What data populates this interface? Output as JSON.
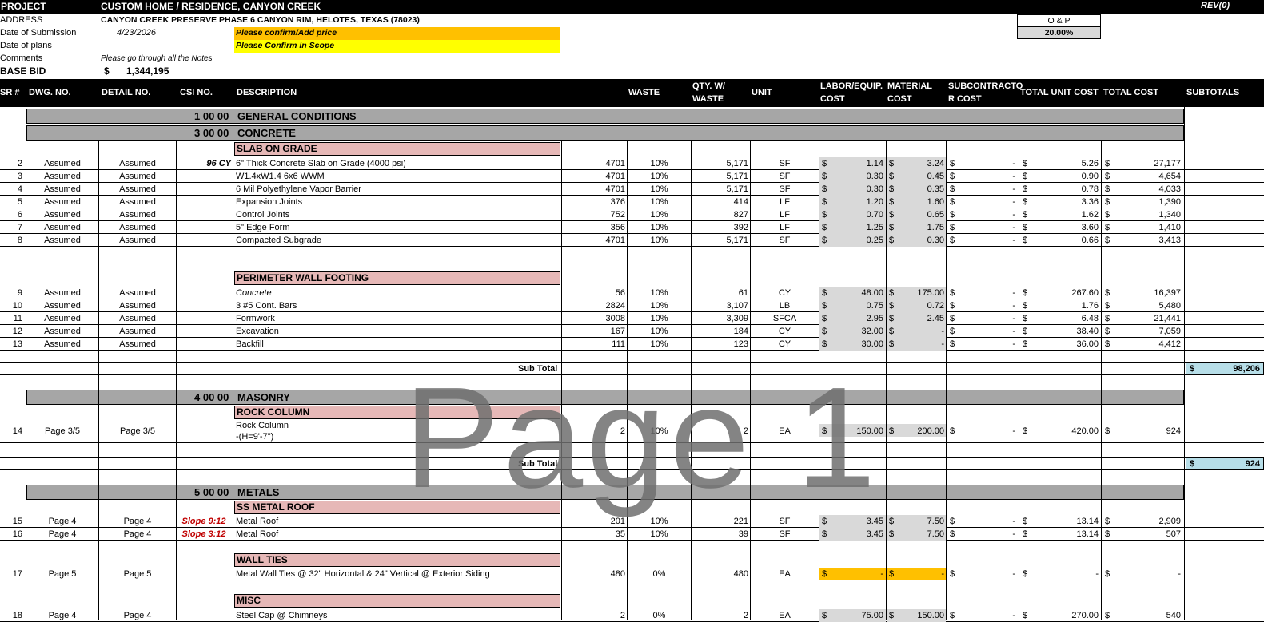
{
  "header": {
    "project_label": "PROJECT",
    "project_value": "CUSTOM HOME / RESIDENCE, CANYON CREEK",
    "rev": "REV(0)",
    "address_label": "ADDRESS",
    "address_value": "CANYON CREEK PRESERVE PHASE 6 CANYON RIM, HELOTES, TEXAS (78023)",
    "submission_label": "Date of Submission",
    "submission_value": "4/23/2026",
    "plans_label": "Date of plans",
    "comments_label": "Comments",
    "comments_value": "Please go through all the Notes",
    "base_bid_label": "BASE BID",
    "base_bid_currency": "$",
    "base_bid_value": "1,344,195",
    "note_confirm_price": "Please confirm/Add price",
    "note_confirm_scope": "Please Confirm in Scope",
    "op_label": "O & P",
    "op_value": "20.00%",
    "colors": {
      "gold": "#ffc000",
      "yellow": "#ffff00",
      "pink": "#e6b8b7",
      "grey": "#a6a6a6",
      "blue": "#b7dee8"
    }
  },
  "columns": {
    "sr": "SR #",
    "dwg": "DWG. NO.",
    "detail": "DETAIL NO.",
    "csi": "CSI NO.",
    "desc": "DESCRIPTION",
    "waste": "WASTE",
    "qty1": "QTY. W/",
    "qty2": "WASTE",
    "unit": "UNIT",
    "labor1": "LABOR/EQUIP.",
    "labor2": "COST",
    "mat1": "MATERIAL",
    "mat2": "COST",
    "subc1": "SUBCONTRACTO",
    "subc2": "R COST",
    "tuc": "TOTAL UNIT COST",
    "tc": "TOTAL COST",
    "subtotals": "SUBTOTALS"
  },
  "sections": {
    "gen": {
      "code": "1 00 00",
      "name": "GENERAL CONDITIONS"
    },
    "conc": {
      "code": "3 00 00",
      "name": "CONCRETE"
    },
    "mas": {
      "code": "4 00 00",
      "name": "MASONRY"
    },
    "met": {
      "code": "5 00 00",
      "name": "METALS"
    }
  },
  "subsections": {
    "slab": "SLAB ON GRADE",
    "wall": "PERIMETER WALL FOOTING",
    "rock": "ROCK COLUMN",
    "roof": "SS METAL ROOF",
    "ties": "WALL TIES",
    "misc": "MISC"
  },
  "subtotal_label": "Sub Total",
  "subtotal_concrete": "98,206",
  "subtotal_masonry": "924",
  "dollar": "$",
  "dash": "-",
  "rows": [
    {
      "sr": "2",
      "dwg": "Assumed",
      "det": "Assumed",
      "csi": "96 CY",
      "desc": "6\" Thick Concrete Slab on Grade (4000 psi)",
      "qty": "4701",
      "waste": "10%",
      "qtyw": "5,171",
      "unit": "SF",
      "lab": "1.14",
      "mat": "3.24",
      "sub": "-",
      "tuc": "5.26",
      "tc": "27,177"
    },
    {
      "sr": "3",
      "dwg": "Assumed",
      "det": "Assumed",
      "csi": "",
      "desc": "W1.4xW1.4 6x6 WWM",
      "qty": "4701",
      "waste": "10%",
      "qtyw": "5,171",
      "unit": "SF",
      "lab": "0.30",
      "mat": "0.45",
      "sub": "-",
      "tuc": "0.90",
      "tc": "4,654"
    },
    {
      "sr": "4",
      "dwg": "Assumed",
      "det": "Assumed",
      "csi": "",
      "desc": "6 Mil Polyethylene Vapor Barrier",
      "qty": "4701",
      "waste": "10%",
      "qtyw": "5,171",
      "unit": "SF",
      "lab": "0.30",
      "mat": "0.35",
      "sub": "-",
      "tuc": "0.78",
      "tc": "4,033"
    },
    {
      "sr": "5",
      "dwg": "Assumed",
      "det": "Assumed",
      "csi": "",
      "desc": "Expansion Joints",
      "qty": "376",
      "waste": "10%",
      "qtyw": "414",
      "unit": "LF",
      "lab": "1.20",
      "mat": "1.60",
      "sub": "-",
      "tuc": "3.36",
      "tc": "1,390"
    },
    {
      "sr": "6",
      "dwg": "Assumed",
      "det": "Assumed",
      "csi": "",
      "desc": "Control Joints",
      "qty": "752",
      "waste": "10%",
      "qtyw": "827",
      "unit": "LF",
      "lab": "0.70",
      "mat": "0.65",
      "sub": "-",
      "tuc": "1.62",
      "tc": "1,340"
    },
    {
      "sr": "7",
      "dwg": "Assumed",
      "det": "Assumed",
      "csi": "",
      "desc": "5\" Edge Form",
      "qty": "356",
      "waste": "10%",
      "qtyw": "392",
      "unit": "LF",
      "lab": "1.25",
      "mat": "1.75",
      "sub": "-",
      "tuc": "3.60",
      "tc": "1,410"
    },
    {
      "sr": "8",
      "dwg": "Assumed",
      "det": "Assumed",
      "csi": "",
      "desc": "Compacted Subgrade",
      "qty": "4701",
      "waste": "10%",
      "qtyw": "5,171",
      "unit": "SF",
      "lab": "0.25",
      "mat": "0.30",
      "sub": "-",
      "tuc": "0.66",
      "tc": "3,413"
    },
    {
      "sr": "9",
      "dwg": "Assumed",
      "det": "Assumed",
      "csi": "",
      "desc": "Concrete",
      "qty": "56",
      "waste": "10%",
      "qtyw": "61",
      "unit": "CY",
      "lab": "48.00",
      "mat": "175.00",
      "sub": "-",
      "tuc": "267.60",
      "tc": "16,397"
    },
    {
      "sr": "10",
      "dwg": "Assumed",
      "det": "Assumed",
      "csi": "",
      "desc": "3 #5 Cont. Bars",
      "qty": "2824",
      "waste": "10%",
      "qtyw": "3,107",
      "unit": "LB",
      "lab": "0.75",
      "mat": "0.72",
      "sub": "-",
      "tuc": "1.76",
      "tc": "5,480"
    },
    {
      "sr": "11",
      "dwg": "Assumed",
      "det": "Assumed",
      "csi": "",
      "desc": "Formwork",
      "qty": "3008",
      "waste": "10%",
      "qtyw": "3,309",
      "unit": "SFCA",
      "lab": "2.95",
      "mat": "2.45",
      "sub": "-",
      "tuc": "6.48",
      "tc": "21,441"
    },
    {
      "sr": "12",
      "dwg": "Assumed",
      "det": "Assumed",
      "csi": "",
      "desc": "Excavation",
      "qty": "167",
      "waste": "10%",
      "qtyw": "184",
      "unit": "CY",
      "lab": "32.00",
      "mat": "-",
      "sub": "-",
      "tuc": "38.40",
      "tc": "7,059"
    },
    {
      "sr": "13",
      "dwg": "Assumed",
      "det": "Assumed",
      "csi": "",
      "desc": "Backfill",
      "qty": "111",
      "waste": "10%",
      "qtyw": "123",
      "unit": "CY",
      "lab": "30.00",
      "mat": "-",
      "sub": "-",
      "tuc": "36.00",
      "tc": "4,412"
    },
    {
      "sr": "14",
      "dwg": "Page 3/5",
      "det": "Page 3/5",
      "csi": "",
      "desc": "Rock Column",
      "desc2": "-(H=9'-7\")",
      "qty": "2",
      "waste": "10%",
      "qtyw": "2",
      "unit": "EA",
      "lab": "150.00",
      "mat": "200.00",
      "sub": "-",
      "tuc": "420.00",
      "tc": "924"
    },
    {
      "sr": "15",
      "dwg": "Page 4",
      "det": "Page 4",
      "csi": "Slope 9:12",
      "desc": "Metal Roof",
      "qty": "201",
      "waste": "10%",
      "qtyw": "221",
      "unit": "SF",
      "lab": "3.45",
      "mat": "7.50",
      "sub": "-",
      "tuc": "13.14",
      "tc": "2,909"
    },
    {
      "sr": "16",
      "dwg": "Page 4",
      "det": "Page 4",
      "csi": "Slope 3:12",
      "desc": "Metal Roof",
      "qty": "35",
      "waste": "10%",
      "qtyw": "39",
      "unit": "SF",
      "lab": "3.45",
      "mat": "7.50",
      "sub": "-",
      "tuc": "13.14",
      "tc": "507"
    },
    {
      "sr": "17",
      "dwg": "Page 5",
      "det": "Page 5",
      "csi": "",
      "desc": "Metal Wall Ties @ 32\" Horizontal & 24\" Vertical @ Exterior Siding",
      "qty": "480",
      "waste": "0%",
      "qtyw": "480",
      "unit": "EA",
      "lab": "-",
      "mat": "-",
      "sub": "-",
      "tuc": "-",
      "tc": "-"
    },
    {
      "sr": "18",
      "dwg": "Page 4",
      "det": "Page 4",
      "csi": "",
      "desc": "Steel Cap @ Chimneys",
      "qty": "2",
      "waste": "0%",
      "qtyw": "2",
      "unit": "EA",
      "lab": "75.00",
      "mat": "150.00",
      "sub": "-",
      "tuc": "270.00",
      "tc": "540"
    }
  ],
  "watermark": "Page 1"
}
